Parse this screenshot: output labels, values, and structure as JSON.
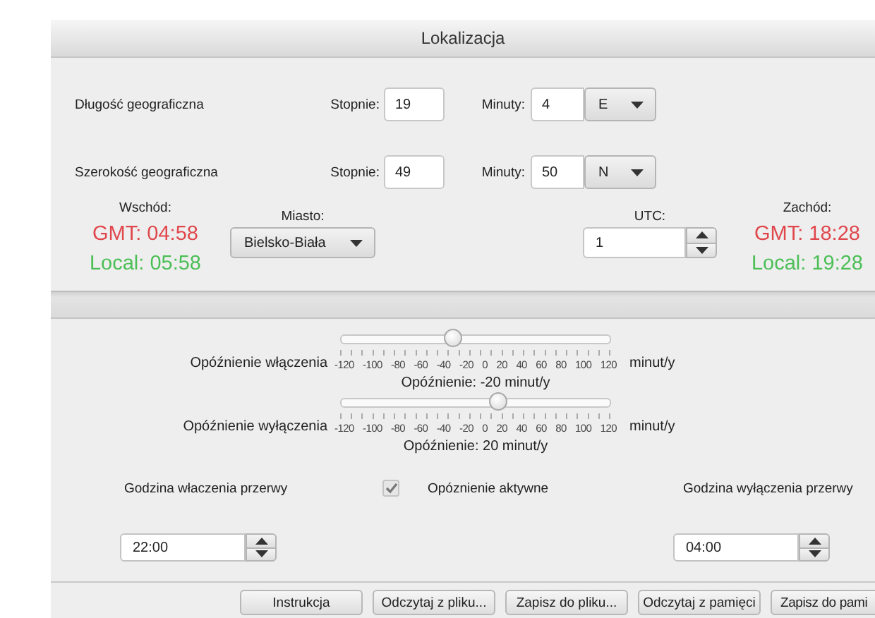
{
  "window": {
    "title": "Lokalizacja"
  },
  "coordinates": [
    {
      "label": "Długość geograficzna",
      "degrees_label": "Stopnie:",
      "degrees": "19",
      "minutes_label": "Minuty:",
      "minutes": "4",
      "direction": "E"
    },
    {
      "label": "Szerokość geograficzna",
      "degrees_label": "Stopnie:",
      "degrees": "49",
      "minutes_label": "Minuty:",
      "minutes": "50",
      "direction": "N"
    }
  ],
  "sunrise": {
    "label": "Wschód:",
    "gmt": "GMT: 04:58",
    "local": "Local: 05:58"
  },
  "city": {
    "label": "Miasto:",
    "value": "Bielsko-Biała"
  },
  "utc": {
    "label": "UTC:",
    "value": "1"
  },
  "sunset": {
    "label": "Zachód:",
    "gmt": "GMT: 18:28",
    "local": "Local: 19:28"
  },
  "delays": [
    {
      "label": "Opóźnienie włączenia",
      "level": 0.4167,
      "ticks": [
        "-120",
        "-100",
        "-80",
        "-60",
        "-40",
        "-20",
        "0",
        "20",
        "40",
        "60",
        "80",
        "100",
        "120"
      ],
      "unit": "minut/y",
      "reading": "Opóźnienie: -20 minut/y"
    },
    {
      "label": "Opóźnienie wyłączenia",
      "level": 0.5833,
      "ticks": [
        "-120",
        "-100",
        "-80",
        "-60",
        "-40",
        "-20",
        "0",
        "20",
        "40",
        "60",
        "80",
        "100",
        "120"
      ],
      "unit": "minut/y",
      "reading": "Opóźnienie: 20 minut/y"
    }
  ],
  "break": {
    "start_label": "Godzina właczenia przerwy",
    "delay_active": {
      "label": "Opóznienie aktywne",
      "checked": true
    },
    "end_label": "Godzina wyłączenia przerwy",
    "start": "22:00",
    "end": "04:00"
  },
  "buttons": [
    "Instrukcja",
    "Odczytaj z pliku...",
    "Zapisz do pliku...",
    "Odczytaj z pamięci",
    "Zapisz do pami"
  ]
}
